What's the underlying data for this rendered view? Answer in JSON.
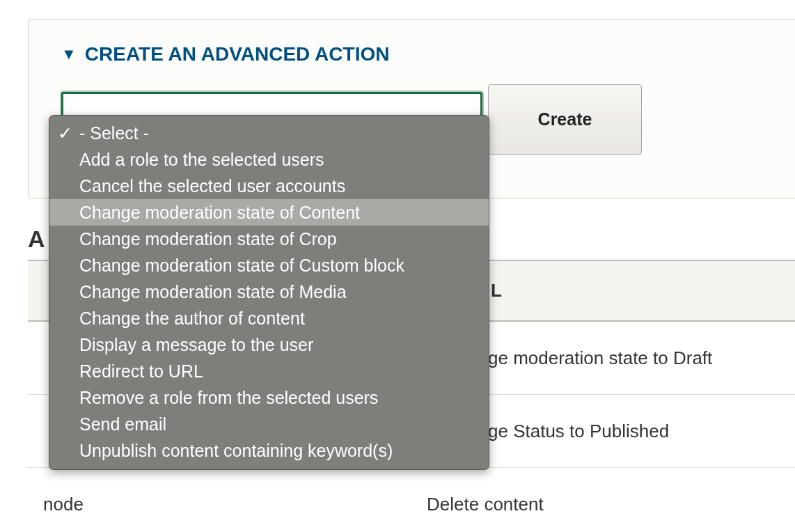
{
  "advanced_action": {
    "toggle": "▼",
    "title": "CREATE AN ADVANCED ACTION",
    "select": {
      "options": [
        {
          "label": "- Select -",
          "checked": true,
          "selected": false
        },
        {
          "label": "Add a role to the selected users",
          "checked": false,
          "selected": false
        },
        {
          "label": "Cancel the selected user accounts",
          "checked": false,
          "selected": false
        },
        {
          "label": "Change moderation state of Content",
          "checked": false,
          "selected": true
        },
        {
          "label": "Change moderation state of Crop",
          "checked": false,
          "selected": false
        },
        {
          "label": "Change moderation state of Custom block",
          "checked": false,
          "selected": false
        },
        {
          "label": "Change moderation state of Media",
          "checked": false,
          "selected": false
        },
        {
          "label": "Change the author of content",
          "checked": false,
          "selected": false
        },
        {
          "label": "Display a message to the user",
          "checked": false,
          "selected": false
        },
        {
          "label": "Redirect to URL",
          "checked": false,
          "selected": false
        },
        {
          "label": "Remove a role from the selected users",
          "checked": false,
          "selected": false
        },
        {
          "label": "Send email",
          "checked": false,
          "selected": false
        },
        {
          "label": "Unpublish content containing keyword(s)",
          "checked": false,
          "selected": false
        }
      ],
      "check_mark": "✓"
    },
    "button": "Create"
  },
  "available_actions": {
    "heading": "A",
    "table": {
      "header": {
        "column_2": "L"
      },
      "rows": [
        {
          "column_2": "ge moderation state to Draft",
          "kind": "cut"
        },
        {
          "column_2": "ge Status to Published",
          "kind": "cut"
        },
        {
          "column_1": "node",
          "column_2": "Delete content",
          "kind": "full"
        }
      ]
    }
  }
}
